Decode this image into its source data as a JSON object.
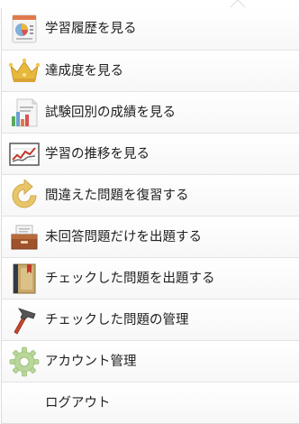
{
  "menu": {
    "items": [
      {
        "label": "学習履歴を見る",
        "icon": "chart-document-icon"
      },
      {
        "label": "達成度を見る",
        "icon": "crown-icon"
      },
      {
        "label": "試験回別の成績を見る",
        "icon": "report-bar-chart-icon"
      },
      {
        "label": "学習の推移を見る",
        "icon": "line-graph-icon"
      },
      {
        "label": "間違えた問題を復習する",
        "icon": "refresh-arrow-icon"
      },
      {
        "label": "未回答問題だけを出題する",
        "icon": "file-drawer-icon"
      },
      {
        "label": "チェックした問題を出題する",
        "icon": "bookmarked-book-icon"
      },
      {
        "label": "チェックした問題の管理",
        "icon": "hammer-icon"
      },
      {
        "label": "アカウント管理",
        "icon": "gear-icon"
      },
      {
        "label": "ログアウト",
        "icon": ""
      }
    ]
  },
  "colors": {
    "border": "#dcdcdc",
    "text": "#222222",
    "crown": "#e8b83c",
    "refresh": "#e9c56a",
    "gear": "#b9d79a",
    "hammer_head": "#555555",
    "hammer_handle": "#c8462e"
  }
}
